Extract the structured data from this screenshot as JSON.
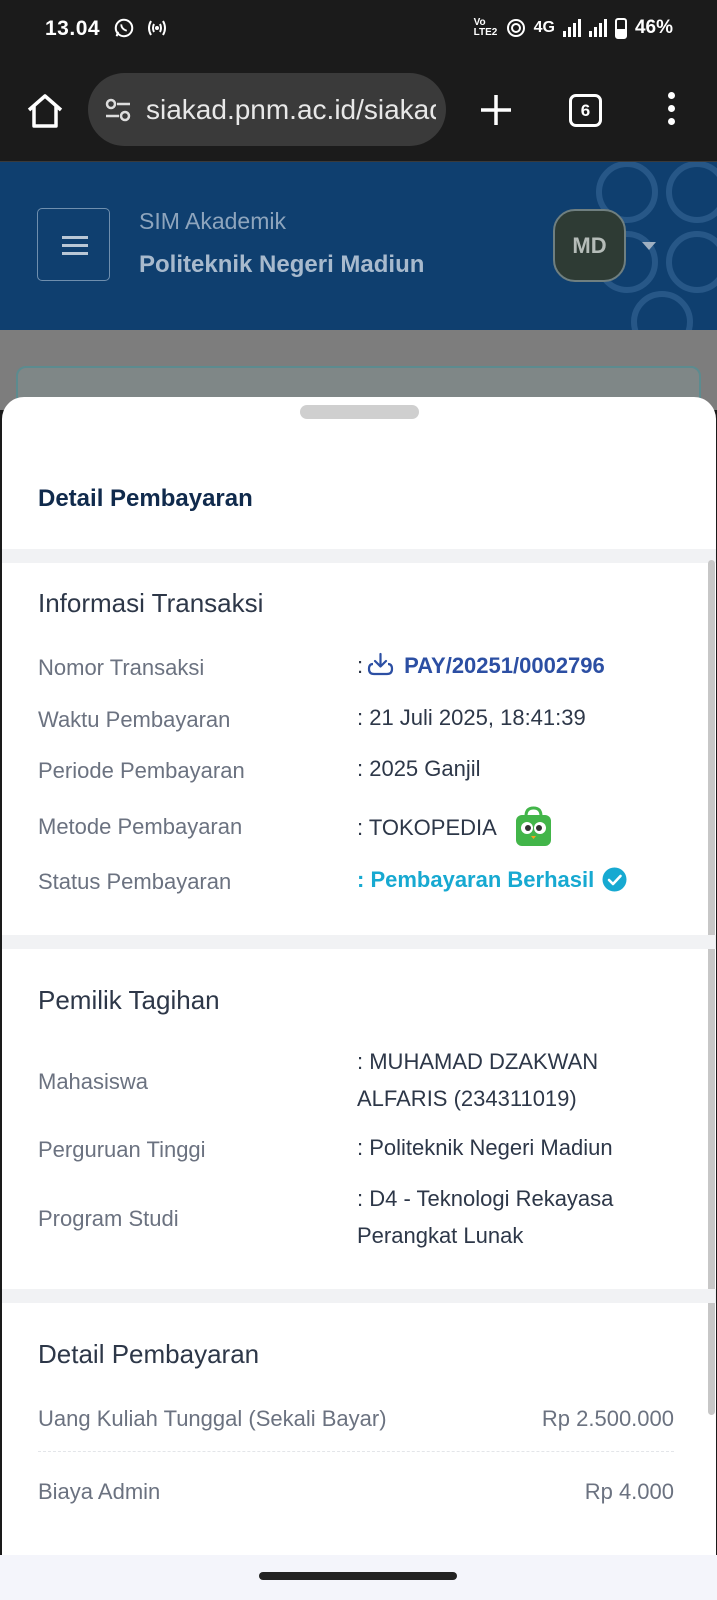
{
  "status_bar": {
    "time": "13.04",
    "volte": "Vo LTE2",
    "network": "4G",
    "battery": "46%"
  },
  "browser": {
    "url": "siakad.pnm.ac.id/siakad",
    "tab_count": "6"
  },
  "app_header": {
    "subtitle": "SIM Akademik",
    "title": "Politeknik Negeri Madiun",
    "avatar_initials": "MD"
  },
  "sheet": {
    "title": "Detail Pembayaran",
    "transaction": {
      "heading": "Informasi Transaksi",
      "rows": [
        {
          "label": "Nomor Transaksi",
          "value": "PAY/20251/0002796"
        },
        {
          "label": "Waktu Pembayaran",
          "value": ": 21 Juli 2025, 18:41:39"
        },
        {
          "label": "Periode Pembayaran",
          "value": ": 2025 Ganjil"
        },
        {
          "label": "Metode Pembayaran",
          "value": ": TOKOPEDIA"
        },
        {
          "label": "Status Pembayaran",
          "value": ": Pembayaran Berhasil"
        }
      ]
    },
    "owner": {
      "heading": "Pemilik Tagihan",
      "rows": [
        {
          "label": "Mahasiswa",
          "line1": ": MUHAMAD DZAKWAN",
          "line2": "ALFARIS (234311019)"
        },
        {
          "label": "Perguruan Tinggi",
          "line1": ": Politeknik Negeri Madiun"
        },
        {
          "label": "Program Studi",
          "line1": ": D4 - Teknologi Rekayasa",
          "line2": "Perangkat Lunak"
        }
      ]
    },
    "payment": {
      "heading": "Detail Pembayaran",
      "items": [
        {
          "label": "Uang Kuliah Tunggal (Sekali Bayar)",
          "amount": "Rp 2.500.000"
        },
        {
          "label": "Biaya Admin",
          "amount": "Rp 4.000"
        }
      ]
    },
    "colon": ":"
  },
  "colors": {
    "header_bg": "#0f3f6f",
    "link": "#2c4fa3",
    "success": "#17a9d1",
    "heading": "#102a4c"
  },
  "icons": [
    "whatsapp-icon",
    "hotspot-icon",
    "wifi-icon",
    "signal-icon",
    "battery-icon",
    "home-icon",
    "tune-icon",
    "plus-icon",
    "more-icon",
    "menu-icon",
    "caret-down-icon",
    "download-icon",
    "tokopedia-icon",
    "check-circle-icon"
  ]
}
